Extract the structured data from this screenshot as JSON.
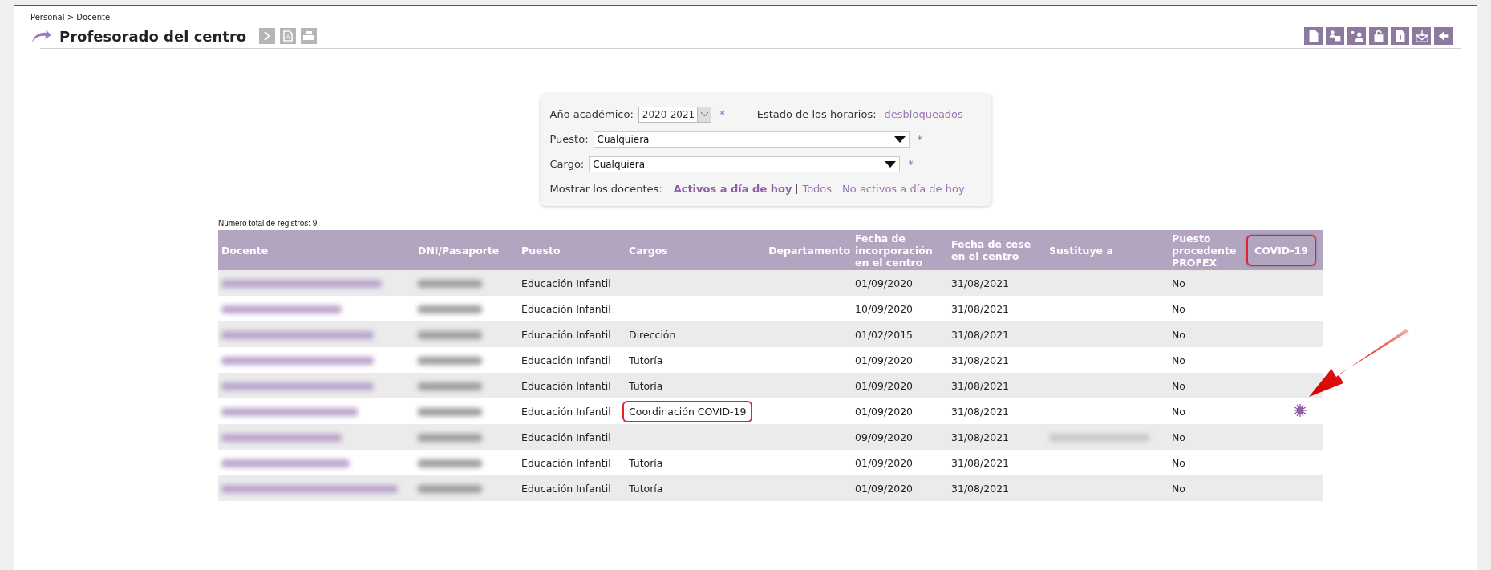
{
  "breadcrumb": "Personal > Docente",
  "title": "Profesorado del centro",
  "filters": {
    "year": {
      "label": "Año académico:",
      "value": "2020-2021",
      "required": "*"
    },
    "schedule": {
      "label": "Estado de los horarios:",
      "value": "desbloqueados"
    },
    "puesto": {
      "label": "Puesto:",
      "value": "Cualquiera",
      "required": "*"
    },
    "cargo": {
      "label": "Cargo:",
      "value": "Cualquiera",
      "required": "*"
    },
    "show": {
      "label": "Mostrar los docentes:",
      "options": [
        {
          "label": "Activos a día de hoy",
          "selected": true
        },
        {
          "label": "Todos",
          "selected": false
        },
        {
          "label": "No activos a día de hoy",
          "selected": false
        }
      ]
    }
  },
  "table": {
    "record_count": "Número total de registros: 9",
    "columns": [
      {
        "label": "Docente",
        "highlighted": false
      },
      {
        "label": "DNI/Pasaporte",
        "highlighted": false
      },
      {
        "label": "Puesto",
        "highlighted": false
      },
      {
        "label": "Cargos",
        "highlighted": false
      },
      {
        "label": "Departamento",
        "highlighted": false
      },
      {
        "label": "Fecha de incorporación en el centro",
        "highlighted": false
      },
      {
        "label": "Fecha de cese en el centro",
        "highlighted": false
      },
      {
        "label": "Sustituye a",
        "highlighted": false
      },
      {
        "label": "Puesto procedente PROFEX",
        "highlighted": false
      },
      {
        "label": "COVID-19",
        "highlighted": true
      }
    ],
    "rows": [
      {
        "puesto": "Educación Infantil",
        "cargos_highlighted": false,
        "fecha_incorporacion": "01/09/2020",
        "fecha_cese": "31/08/2021",
        "sustituye_blurred": false,
        "profex": "No",
        "covid": false
      },
      {
        "puesto": "Educación Infantil",
        "cargos_highlighted": false,
        "fecha_incorporacion": "10/09/2020",
        "fecha_cese": "31/08/2021",
        "sustituye_blurred": false,
        "profex": "No",
        "covid": false
      },
      {
        "puesto": "Educación Infantil",
        "cargos": "Dirección",
        "cargos_highlighted": false,
        "fecha_incorporacion": "01/02/2015",
        "fecha_cese": "31/08/2021",
        "sustituye_blurred": false,
        "profex": "No",
        "covid": false
      },
      {
        "puesto": "Educación Infantil",
        "cargos": "Tutoría",
        "cargos_highlighted": false,
        "fecha_incorporacion": "01/09/2020",
        "fecha_cese": "31/08/2021",
        "sustituye_blurred": false,
        "profex": "No",
        "covid": false
      },
      {
        "puesto": "Educación Infantil",
        "cargos": "Tutoría",
        "cargos_highlighted": false,
        "fecha_incorporacion": "01/09/2020",
        "fecha_cese": "31/08/2021",
        "sustituye_blurred": false,
        "profex": "No",
        "covid": false
      },
      {
        "puesto": "Educación Infantil",
        "cargos": "Coordinación COVID-19",
        "cargos_highlighted": true,
        "fecha_incorporacion": "01/09/2020",
        "fecha_cese": "31/08/2021",
        "sustituye_blurred": false,
        "profex": "No",
        "covid": true
      },
      {
        "puesto": "Educación Infantil",
        "cargos_highlighted": false,
        "fecha_incorporacion": "09/09/2020",
        "fecha_cese": "31/08/2021",
        "sustituye_blurred": true,
        "profex": "No",
        "covid": false
      },
      {
        "puesto": "Educación Infantil",
        "cargos": "Tutoría",
        "cargos_highlighted": false,
        "fecha_incorporacion": "01/09/2020",
        "fecha_cese": "31/08/2021",
        "sustituye_blurred": false,
        "profex": "No",
        "covid": false
      },
      {
        "puesto": "Educación Infantil",
        "cargos": "Tutoría",
        "cargos_highlighted": false,
        "fecha_incorporacion": "01/09/2020",
        "fecha_cese": "31/08/2021",
        "sustituye_blurred": false,
        "profex": "No",
        "covid": false
      }
    ]
  }
}
